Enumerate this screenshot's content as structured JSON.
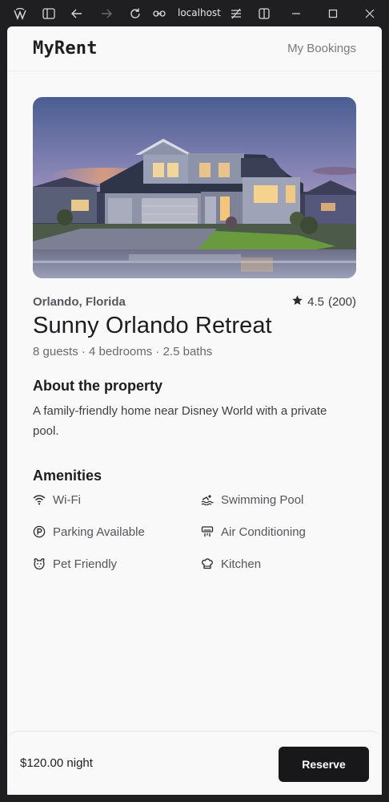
{
  "browser": {
    "url": "localhost"
  },
  "header": {
    "brand": "MyRent",
    "nav_link": "My Bookings"
  },
  "listing": {
    "location": "Orlando, Florida",
    "rating": "4.5",
    "reviews": "(200)",
    "title": "Sunny Orlando Retreat",
    "specs": "8 guests · 4 bedrooms · 2.5 baths",
    "about_heading": "About the property",
    "about_text": "A family-friendly home near Disney World with a private pool.",
    "amenities_heading": "Amenities",
    "amenities": [
      {
        "label": "Wi-Fi",
        "icon": "wifi-icon"
      },
      {
        "label": "Swimming Pool",
        "icon": "swimming-pool-icon"
      },
      {
        "label": "Parking Available",
        "icon": "parking-icon"
      },
      {
        "label": "Air Conditioning",
        "icon": "air-conditioning-icon"
      },
      {
        "label": "Pet Friendly",
        "icon": "pet-icon"
      },
      {
        "label": "Kitchen",
        "icon": "kitchen-icon"
      }
    ]
  },
  "footer": {
    "price": "$120.00",
    "price_unit": "night",
    "reserve_label": "Reserve"
  },
  "colors": {
    "page_bg": "#f9f9fa",
    "reserve_bg": "#18181a",
    "chrome_bg": "#1f1f21"
  }
}
